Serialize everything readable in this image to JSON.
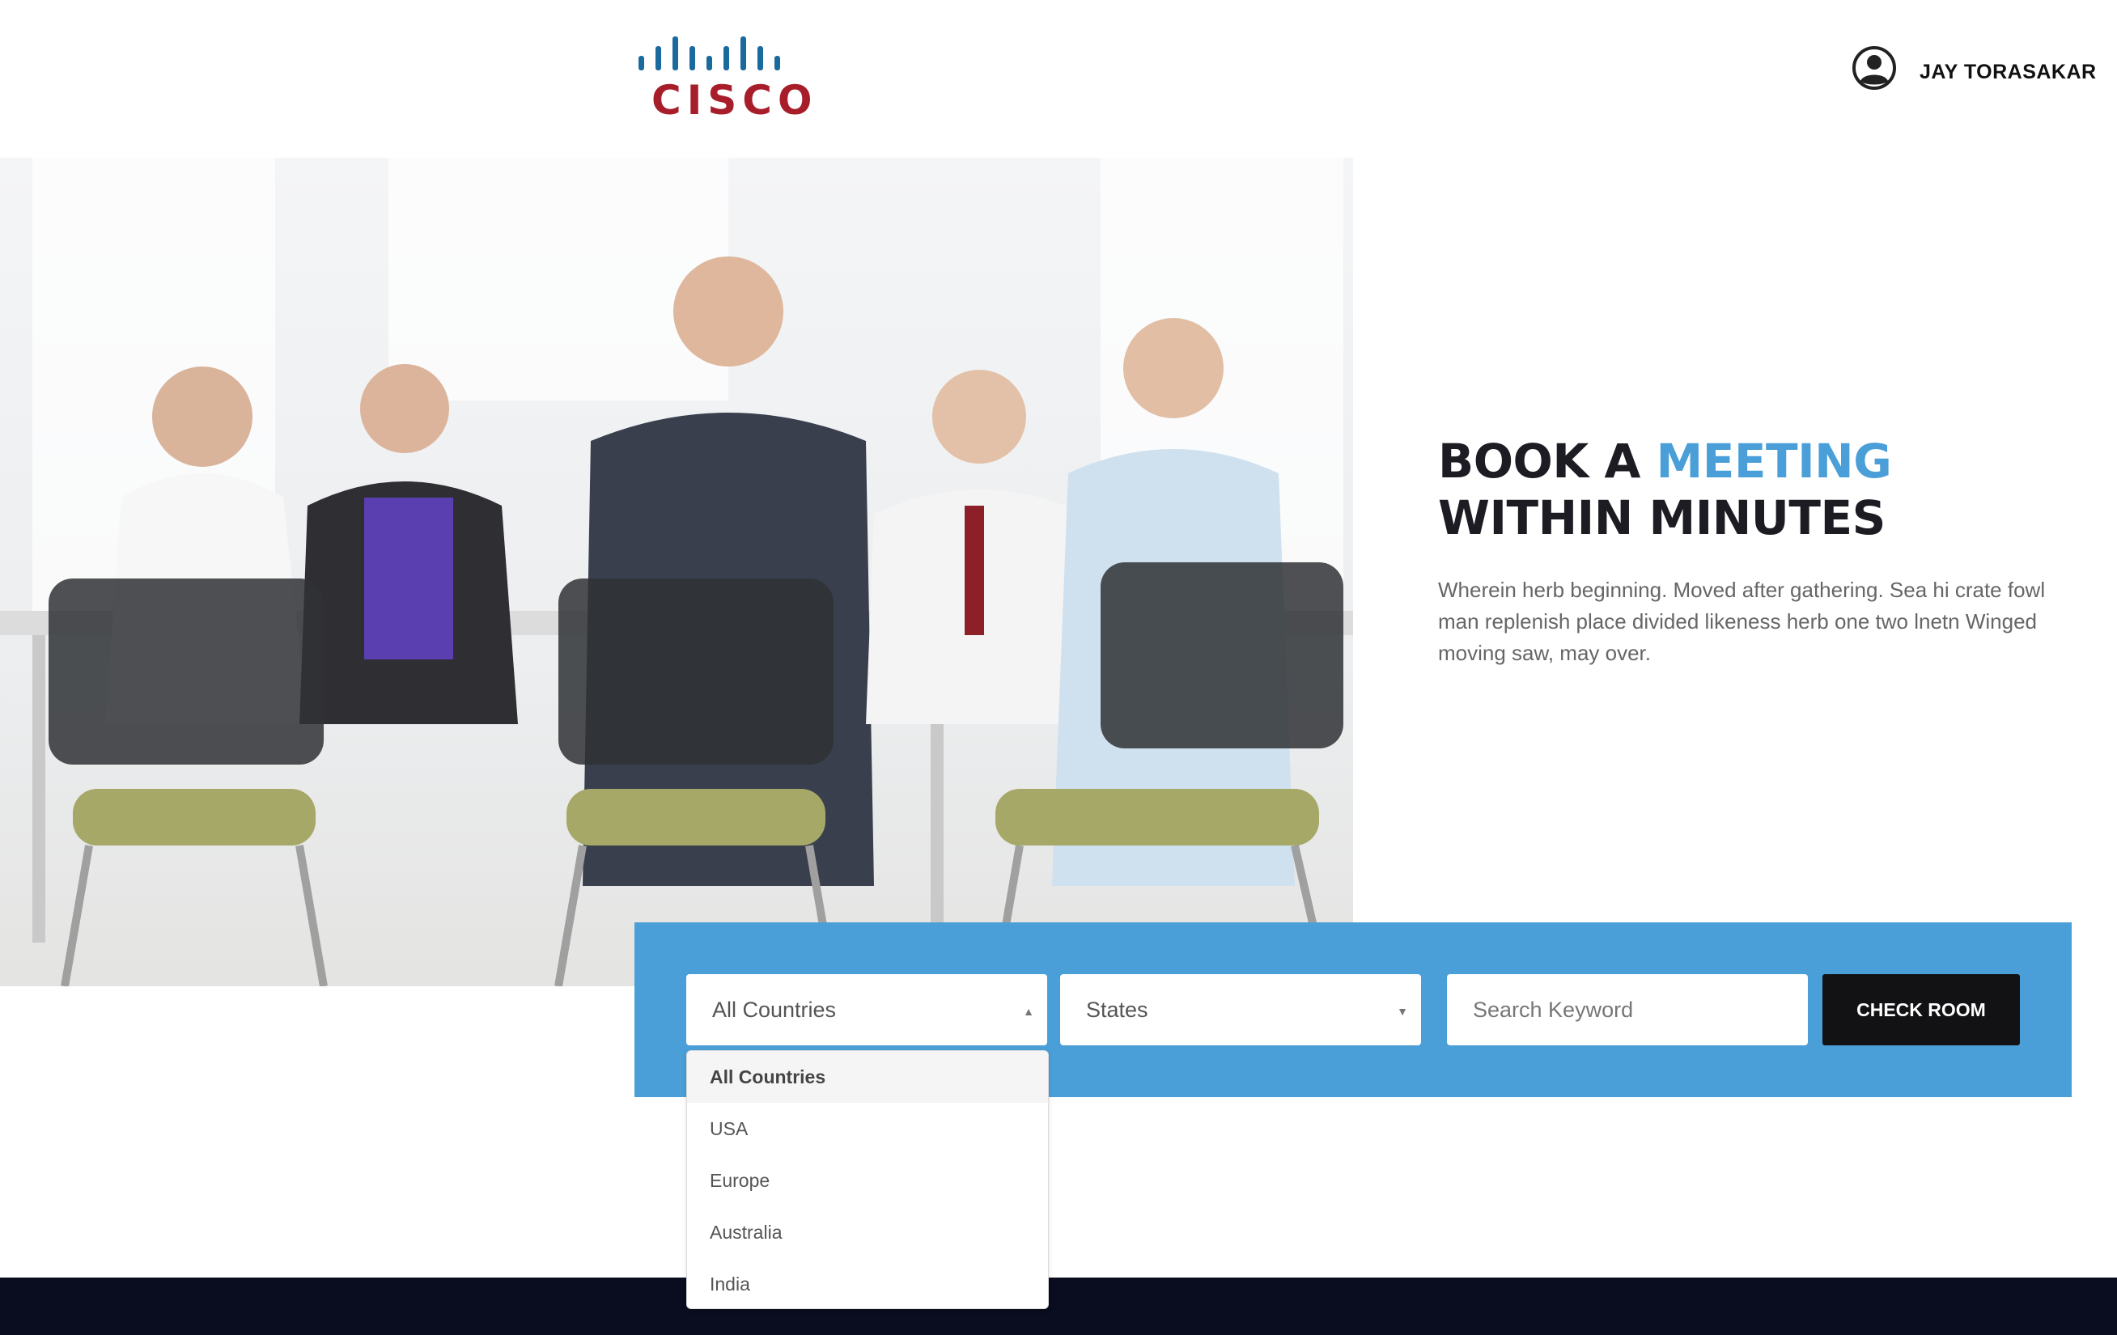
{
  "header": {
    "logo_text": "CISCO",
    "user_name": "JAY TORASAKAR",
    "user_icon": "user-account-icon"
  },
  "hero": {
    "title_part1": "BOOK A ",
    "title_accent": "MEETING",
    "title_part2": " WITHIN MINUTES",
    "description": "Wherein herb beginning. Moved after gathering. Sea hi crate fowl man replenish place divided likeness herb one two lnetn Winged moving saw, may over.",
    "image": "business-team-meeting-photo"
  },
  "search": {
    "country_value": "All Countries",
    "states_value": "States",
    "keyword_placeholder": "Search Keyword",
    "button_label": "CHECK ROOM"
  },
  "dropdown": {
    "options": [
      "All Countries",
      "USA",
      "Europe",
      "Australia",
      "India"
    ]
  },
  "colors": {
    "accent": "#4a9fd8",
    "brand_red": "#a71d2a",
    "footer": "#0a0c1f",
    "button": "#121214"
  }
}
